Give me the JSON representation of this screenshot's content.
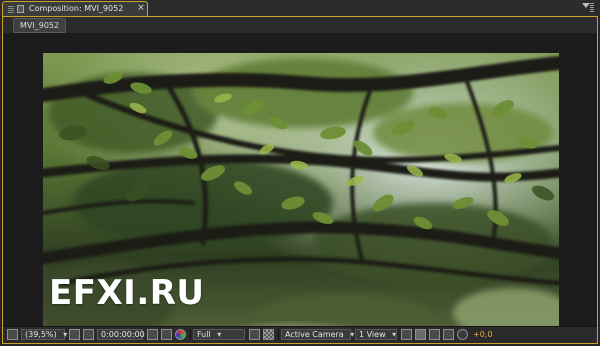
{
  "panel_tab": {
    "title": "Composition: MVI_9052",
    "close_label": "×"
  },
  "viewer": {
    "layer_tab": "MVI_9052"
  },
  "overlay": {
    "watermark": "EFXI.RU"
  },
  "toolbar": {
    "magnification": "(39,5%)",
    "timecode": "0:00:00:00",
    "resolution": "Full",
    "camera": "Active Camera",
    "view_layout": "1 View",
    "exposure": "+0,0"
  },
  "colors": {
    "accent": "#c9a227",
    "panel": "#252525",
    "exposure": "#e0b14a"
  },
  "icons": [
    "grip-icon",
    "lock-icon",
    "close-icon",
    "panel-menu-icon",
    "always-preview-icon",
    "safe-zones-icon",
    "snapshot-icon",
    "color-channel-icon",
    "roi-icon",
    "transparency-grid-icon",
    "toggle-pixel-aspect-icon",
    "fast-previews-icon",
    "flowchart-icon",
    "reset-exposure-icon"
  ]
}
